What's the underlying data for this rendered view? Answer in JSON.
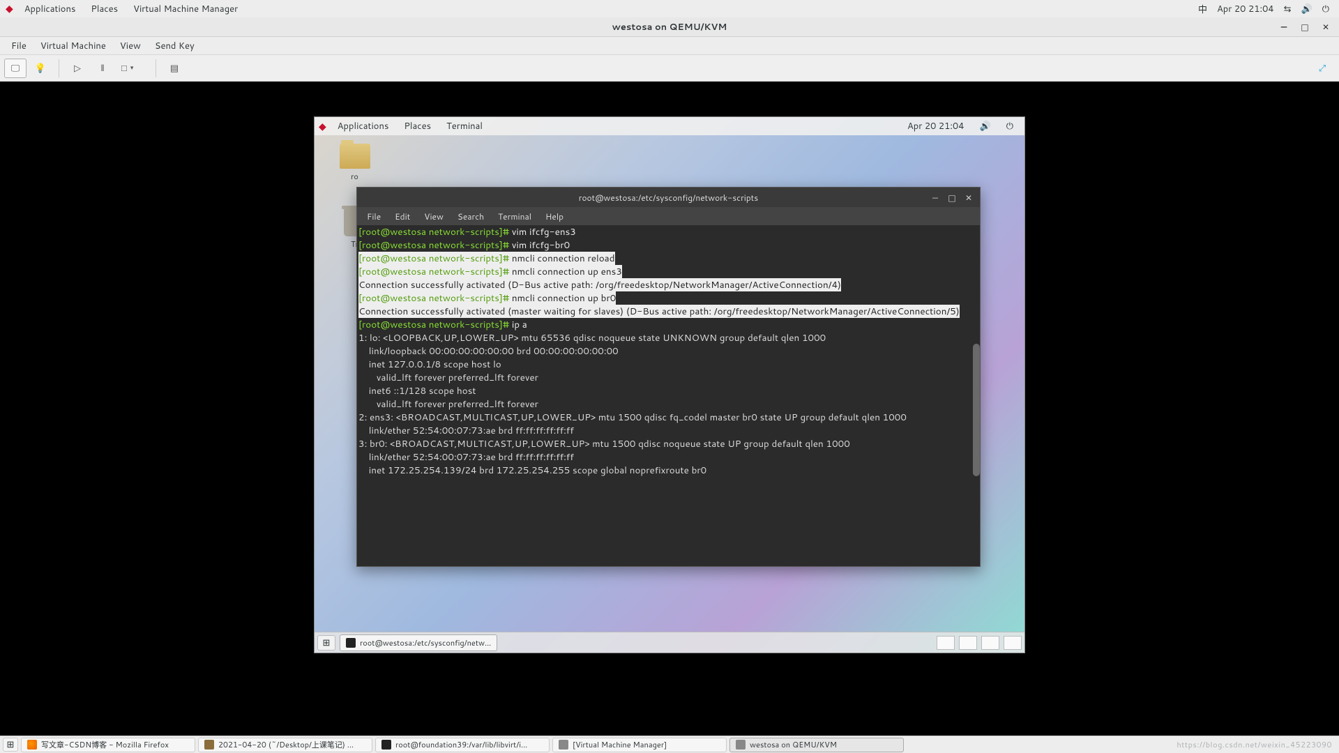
{
  "host_panel": {
    "apps": "Applications",
    "places": "Places",
    "vmm": "Virtual Machine Manager",
    "ime": "中",
    "datetime": "Apr 20  21:04"
  },
  "vmm": {
    "title": "westosa on QEMU/KVM",
    "menu": {
      "file": "File",
      "vm": "Virtual Machine",
      "view": "View",
      "sendkey": "Send Key"
    }
  },
  "guest_panel": {
    "apps": "Applications",
    "places": "Places",
    "terminal": "Terminal",
    "datetime": "Apr 20  21:04"
  },
  "guest_icons": {
    "folder": "ro",
    "trash": "Tr"
  },
  "terminal": {
    "title": "root@westosa:/etc/sysconfig/network-scripts",
    "menu": {
      "file": "File",
      "edit": "Edit",
      "view": "View",
      "search": "Search",
      "terminal": "Terminal",
      "help": "Help"
    },
    "lines": [
      {
        "t": "p",
        "prompt": "[root@westosa network-scripts]# ",
        "cmd": "vim ifcfg-ens3"
      },
      {
        "t": "p",
        "prompt": "[root@westosa network-scripts]# ",
        "cmd": "vim ifcfg-br0"
      },
      {
        "t": "ph",
        "prompt": "[root@westosa network-scripts]# ",
        "cmd": "nmcli connection reload"
      },
      {
        "t": "ph",
        "prompt": "[root@westosa network-scripts]# ",
        "cmd": "nmcli connection up ens3"
      },
      {
        "t": "oh",
        "text": "Connection successfully activated (D-Bus active path: /org/freedesktop/NetworkManager/ActiveConnection/4)"
      },
      {
        "t": "ph",
        "prompt": "[root@westosa network-scripts]# ",
        "cmd": "nmcli connection up br0"
      },
      {
        "t": "oh",
        "text": "Connection successfully activated (master waiting for slaves) (D-Bus active path: /org/freedesktop/NetworkManager/ActiveConnection/5)"
      },
      {
        "t": "p",
        "prompt": "[root@westosa network-scripts]# ",
        "cmd": "ip a"
      },
      {
        "t": "o",
        "text": "1: lo: <LOOPBACK,UP,LOWER_UP> mtu 65536 qdisc noqueue state UNKNOWN group default qlen 1000"
      },
      {
        "t": "o",
        "text": "    link/loopback 00:00:00:00:00:00 brd 00:00:00:00:00:00"
      },
      {
        "t": "o",
        "text": "    inet 127.0.0.1/8 scope host lo"
      },
      {
        "t": "o",
        "text": "       valid_lft forever preferred_lft forever"
      },
      {
        "t": "o",
        "text": "    inet6 ::1/128 scope host"
      },
      {
        "t": "o",
        "text": "       valid_lft forever preferred_lft forever"
      },
      {
        "t": "o",
        "text": "2: ens3: <BROADCAST,MULTICAST,UP,LOWER_UP> mtu 1500 qdisc fq_codel master br0 state UP group default qlen 1000"
      },
      {
        "t": "o",
        "text": "    link/ether 52:54:00:07:73:ae brd ff:ff:ff:ff:ff:ff"
      },
      {
        "t": "o",
        "text": "3: br0: <BROADCAST,MULTICAST,UP,LOWER_UP> mtu 1500 qdisc noqueue state UP group default qlen 1000"
      },
      {
        "t": "o",
        "text": "    link/ether 52:54:00:07:73:ae brd ff:ff:ff:ff:ff:ff"
      },
      {
        "t": "o",
        "text": "    inet 172.25.254.139/24 brd 172.25.254.255 scope global noprefixroute br0"
      }
    ]
  },
  "guest_taskbar": {
    "task": "root@westosa:/etc/sysconfig/netw..."
  },
  "host_taskbar": {
    "t1": "写文章-CSDN博客 - Mozilla Firefox",
    "t2": "2021-04-20 (~/Desktop/上课笔记) ...",
    "t3": "root@foundation39:/var/lib/libvirt/i...",
    "t4": "[Virtual Machine Manager]",
    "t5": "westosa on QEMU/KVM"
  },
  "watermark": "https://blog.csdn.net/weixin_45223090"
}
